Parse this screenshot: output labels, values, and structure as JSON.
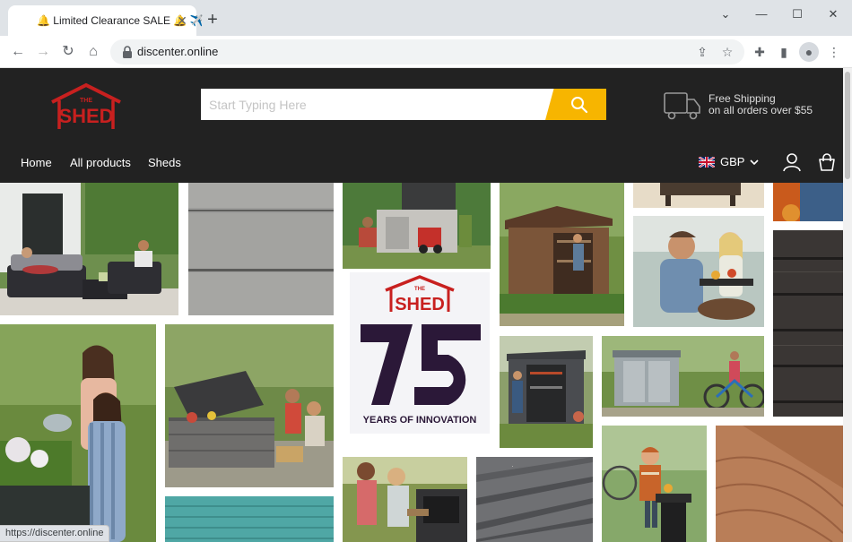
{
  "browser": {
    "tab_title": "🔔 Limited Clearance SALE 🔔 ✈️",
    "url": "discenter.online",
    "status_url": "https://discenter.online"
  },
  "header": {
    "logo_small": "THE",
    "logo_big": "SHED",
    "search_placeholder": "Start Typing Here",
    "shipping_line1": "Free Shipping",
    "shipping_line2": "on all orders over $55",
    "nav": [
      "Home",
      "All products",
      "Sheds"
    ],
    "currency": "GBP"
  },
  "banner": {
    "logo_small": "THE",
    "logo_big": "SHED",
    "tagline": "YEARS OF INNOVATION"
  },
  "colors": {
    "header_bg": "#222222",
    "accent": "#f7b500",
    "brand_red": "#c8201f",
    "brand_purple": "#2b1838"
  }
}
